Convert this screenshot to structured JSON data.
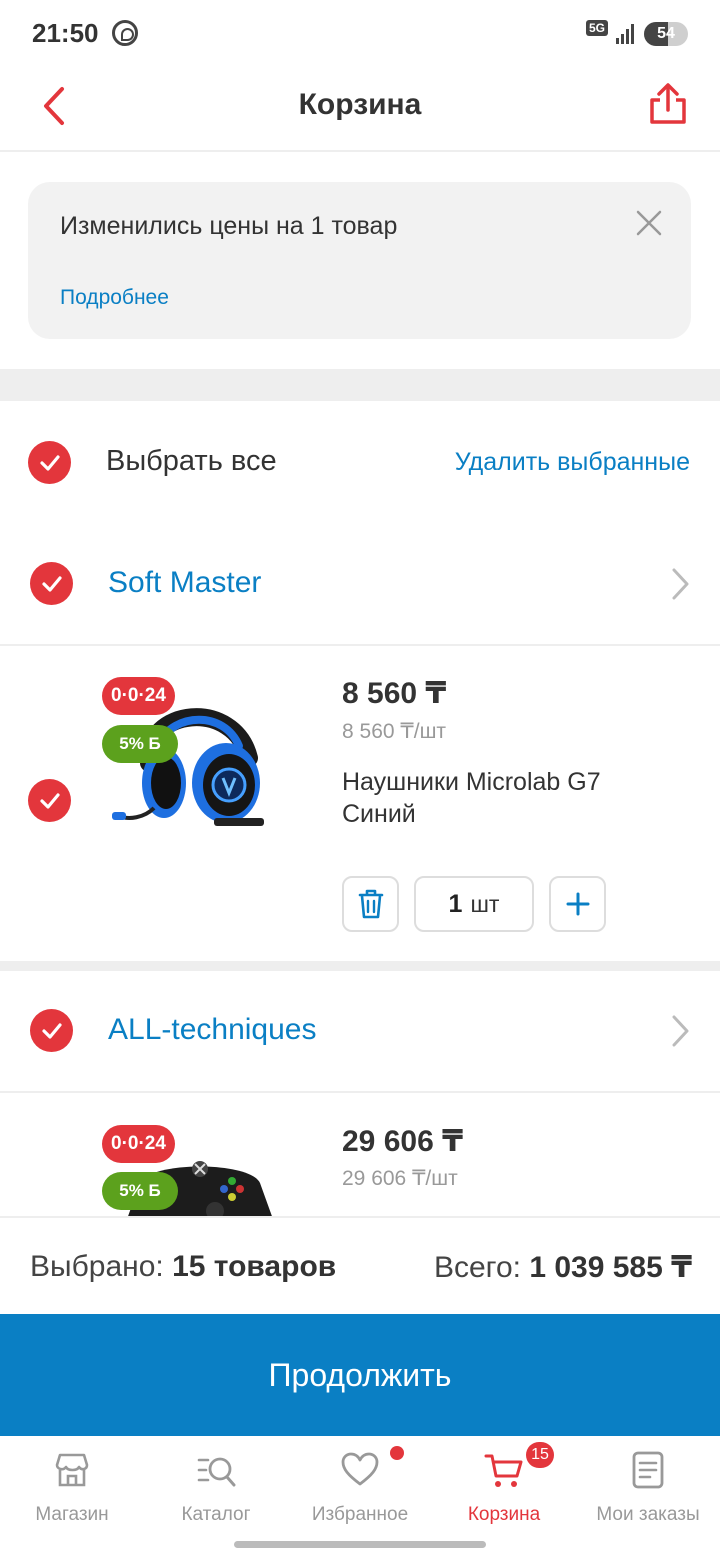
{
  "status_bar": {
    "time": "21:50",
    "network": "5G",
    "battery": "54",
    "battery_level": 0.54
  },
  "header": {
    "title": "Корзина"
  },
  "notice": {
    "message": "Изменились цены на 1 товар",
    "more_link": "Подробнее"
  },
  "select_all": {
    "label": "Выбрать все",
    "delete_label": "Удалить выбранные"
  },
  "sellers": [
    {
      "name": "Soft Master",
      "product": {
        "badge_installment": "0·0·24",
        "badge_bonus": "5% Б",
        "price": "8 560 ₸",
        "unit_price": "8 560 ₸/шт",
        "name": "Наушники Microlab G7 Синий",
        "quantity": "1",
        "quantity_unit": "шт"
      }
    },
    {
      "name": "ALL-techniques",
      "product": {
        "badge_installment": "0·0·24",
        "badge_bonus": "5% Б",
        "price": "29 606 ₸",
        "unit_price": "29 606 ₸/шт"
      }
    }
  ],
  "summary": {
    "selected_label": "Выбрано:",
    "selected_value": "15 товаров",
    "total_label": "Всего:",
    "total_value": "1 039 585 ₸"
  },
  "continue_label": "Продолжить",
  "bottom_nav": {
    "items": [
      {
        "label": "Магазин",
        "icon": "store-icon"
      },
      {
        "label": "Каталог",
        "icon": "catalog-search-icon"
      },
      {
        "label": "Избранное",
        "icon": "heart-icon"
      },
      {
        "label": "Корзина",
        "icon": "cart-icon"
      },
      {
        "label": "Мои заказы",
        "icon": "orders-icon"
      }
    ],
    "cart_count": "15"
  },
  "colors": {
    "accent_red": "#e3363c",
    "link_blue": "#0a7fc4",
    "bonus_green": "#5ca11d"
  }
}
